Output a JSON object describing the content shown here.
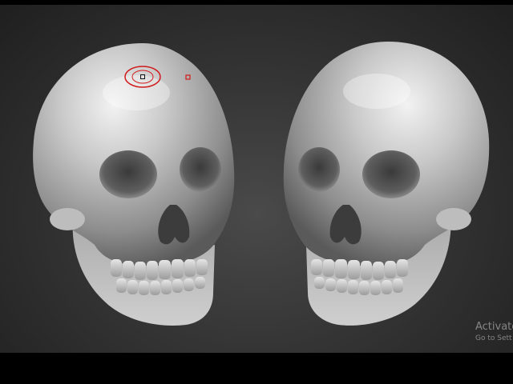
{
  "viewport": {
    "background": "#3a3a3a",
    "models": [
      {
        "name": "skull-left",
        "material": "matcap-gray"
      },
      {
        "name": "skull-right",
        "material": "matcap-gray"
      }
    ],
    "brush_cursor": {
      "icon": "brush-cursor-icon",
      "color": "#d11a1a"
    },
    "pivot_marker": {
      "icon": "pivot-marker-icon",
      "color": "#d11a1a"
    }
  },
  "watermark": {
    "line1": "Activate",
    "line2": "Go to Sett"
  }
}
